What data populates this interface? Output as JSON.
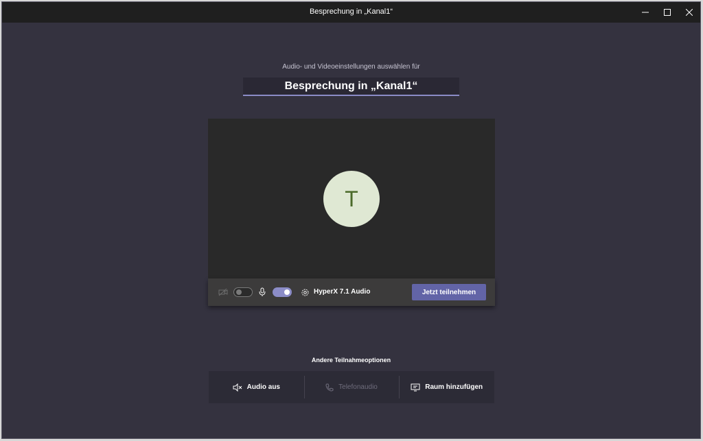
{
  "window": {
    "title": "Besprechung in „Kanal1“",
    "controls": [
      "minimize",
      "maximize",
      "close"
    ]
  },
  "prejoin": {
    "subtitle": "Audio- und Videoeinstellungen auswählen für",
    "meeting_name": "Besprechung in „Kanal1“",
    "avatar_initial": "T"
  },
  "controls": {
    "camera_on": false,
    "mic_on": true,
    "audio_device": "HyperX 7.1 Audio",
    "join_label": "Jetzt teilnehmen"
  },
  "other_options": {
    "heading": "Andere Teilnahmeoptionen",
    "items": [
      {
        "label": "Audio aus",
        "icon": "speaker-mute-icon",
        "enabled": true
      },
      {
        "label": "Telefonaudio",
        "icon": "phone-icon",
        "enabled": false
      },
      {
        "label": "Raum hinzufügen",
        "icon": "room-cast-icon",
        "enabled": true
      }
    ]
  },
  "colors": {
    "accent": "#6264a7",
    "background": "#34323f",
    "titlebar": "#1f1f1f",
    "preview": "#292929",
    "avatar_bg": "#dfe8d3",
    "avatar_text": "#4b6a2a"
  }
}
